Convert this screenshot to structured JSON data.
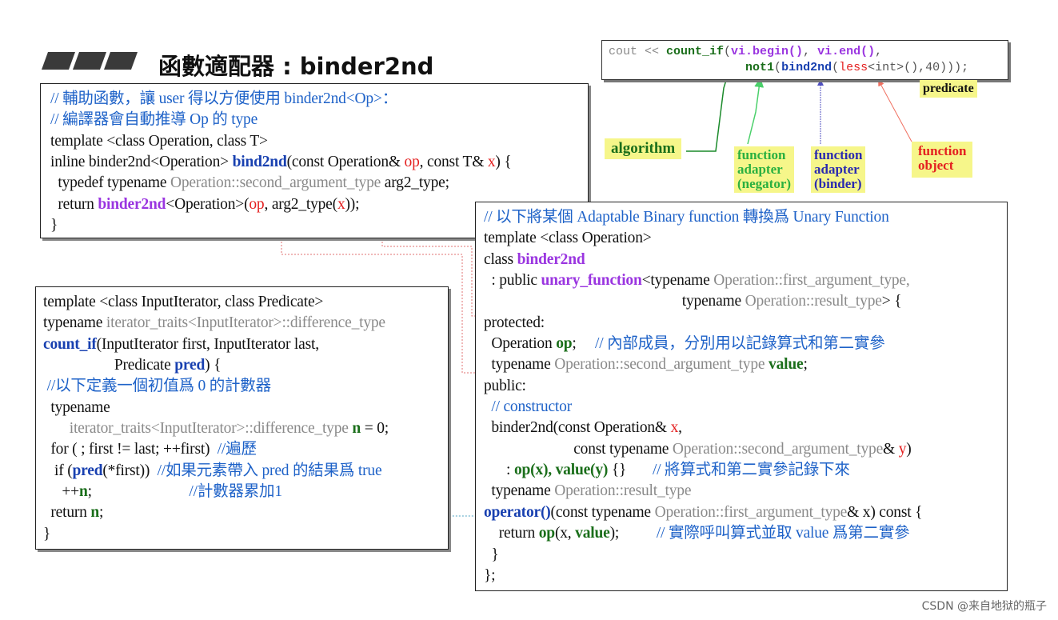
{
  "slide": {
    "title": "函數適配器 : binder2nd",
    "usage_code": [
      [
        [
          "cout << ",
          "gr"
        ],
        [
          "count_if",
          "g"
        ],
        [
          "(",
          "k"
        ],
        [
          "vi.begin()",
          "p"
        ],
        [
          ", ",
          "k"
        ],
        [
          "vi.end()",
          "p"
        ],
        [
          ",",
          "k"
        ]
      ],
      [
        [
          "                   ",
          "k"
        ],
        [
          "not1",
          "g"
        ],
        [
          "(",
          "k"
        ],
        [
          "bind2nd",
          "b"
        ],
        [
          "(",
          "k"
        ],
        [
          "less",
          "r"
        ],
        [
          "<int>(),40)));",
          "k"
        ]
      ]
    ],
    "labels": {
      "predicate": "predicate",
      "algorithm": "algorithm",
      "negator": [
        "function",
        "adapter",
        "(negator)"
      ],
      "binder": [
        "function",
        "adapter",
        "(binder)"
      ],
      "function_object": [
        "function",
        "object"
      ]
    },
    "bind2nd_box": [
      [
        [
          "// 輔助函數，讓 user 得以方便使用 binder2nd<Op>：",
          "c"
        ]
      ],
      [
        [
          "// 編譯器會自動推導 Op 的 type",
          "c"
        ]
      ],
      [
        [
          "template <class Operation, class T>",
          "k"
        ]
      ],
      [
        [
          "inline binder2nd<Operation> ",
          "k"
        ],
        [
          "bind2nd",
          "b"
        ],
        [
          "(const Operation& ",
          "k"
        ],
        [
          "op",
          "r"
        ],
        [
          ", const T& ",
          "k"
        ],
        [
          "x",
          "r"
        ],
        [
          ") {",
          "k"
        ]
      ],
      [
        [
          "  typedef typename ",
          "k"
        ],
        [
          "Operation::second_argument_type",
          "gr"
        ],
        [
          " arg2_type;",
          "k"
        ]
      ],
      [
        [
          "  return ",
          "k"
        ],
        [
          "binder2nd",
          "p"
        ],
        [
          "<Operation>(",
          "k"
        ],
        [
          "op",
          "r"
        ],
        [
          ", arg2_type(",
          "k"
        ],
        [
          "x",
          "r"
        ],
        [
          "));",
          "k"
        ]
      ],
      [
        [
          "}",
          "k"
        ]
      ]
    ],
    "count_if_box": [
      [
        [
          "template <class InputIterator, class Predicate>",
          "k"
        ]
      ],
      [
        [
          "typename ",
          "k"
        ],
        [
          "iterator_traits<InputIterator>::difference_type",
          "gr"
        ]
      ],
      [
        [
          "count_if",
          "b"
        ],
        [
          "(InputIterator first, InputIterator last,",
          "k"
        ]
      ],
      [
        [
          "                   Predicate ",
          "k"
        ],
        [
          "pred",
          "b"
        ],
        [
          ") {",
          "k"
        ]
      ],
      [
        [
          " //以下定義一個初值爲 0 的計數器",
          "c"
        ]
      ],
      [
        [
          "  typename",
          "k"
        ]
      ],
      [
        [
          "       iterator_traits<InputIterator>::difference_type ",
          "gr"
        ],
        [
          "n",
          "g"
        ],
        [
          " = 0;",
          "k"
        ]
      ],
      [
        [
          "  for ( ; first != last; ++first)  ",
          "k"
        ],
        [
          "//遍歷",
          "c"
        ]
      ],
      [
        [
          "   if (",
          "k"
        ],
        [
          "pred",
          "b"
        ],
        [
          "(*first))  ",
          "k"
        ],
        [
          "//如果元素帶入 pred 的結果爲 true",
          "c"
        ]
      ],
      [
        [
          "     ++",
          "k"
        ],
        [
          "n",
          "g"
        ],
        [
          ";                          ",
          "k"
        ],
        [
          "//計數器累加1",
          "c"
        ]
      ],
      [
        [
          "  return ",
          "k"
        ],
        [
          "n",
          "g"
        ],
        [
          ";",
          "k"
        ]
      ],
      [
        [
          "}",
          "k"
        ]
      ]
    ],
    "binder2nd_box": [
      [
        [
          "// 以下將某個 Adaptable Binary function 轉換爲 Unary Function",
          "c"
        ]
      ],
      [
        [
          "template <class Operation>",
          "k"
        ]
      ],
      [
        [
          "class ",
          "k"
        ],
        [
          "binder2nd",
          "p"
        ]
      ],
      [
        [
          "  : public ",
          "k"
        ],
        [
          "unary_function",
          "p"
        ],
        [
          "<typename ",
          "k"
        ],
        [
          "Operation::first_argument_type,",
          "gr"
        ]
      ],
      [
        [
          "                                                     typename ",
          "k"
        ],
        [
          "Operation::result_type",
          "gr"
        ],
        [
          "> {",
          "k"
        ]
      ],
      [
        [
          "protected:",
          "k"
        ]
      ],
      [
        [
          "  Operation ",
          "k"
        ],
        [
          "op",
          "g"
        ],
        [
          ";     ",
          "k"
        ],
        [
          "// 內部成員，分別用以記錄算式和第二實參",
          "c"
        ]
      ],
      [
        [
          "  typename ",
          "k"
        ],
        [
          "Operation::second_argument_type ",
          "gr"
        ],
        [
          "value",
          "g"
        ],
        [
          ";",
          "k"
        ]
      ],
      [
        [
          "public:",
          "k"
        ]
      ],
      [
        [
          "  // constructor",
          "c"
        ]
      ],
      [
        [
          "  binder2nd(const Operation& ",
          "k"
        ],
        [
          "x",
          "r"
        ],
        [
          ",",
          "k"
        ]
      ],
      [
        [
          "                        const typename ",
          "k"
        ],
        [
          "Operation::second_argument_type",
          "gr"
        ],
        [
          "& ",
          "k"
        ],
        [
          "y",
          "r"
        ],
        [
          ")",
          "k"
        ]
      ],
      [
        [
          "      : ",
          "k"
        ],
        [
          "op(x), value(y)",
          "g"
        ],
        [
          " {}       ",
          "k"
        ],
        [
          "// 將算式和第二實參記錄下來",
          "c"
        ]
      ],
      [
        [
          "  typename ",
          "k"
        ],
        [
          "Operation::result_type",
          "gr"
        ]
      ],
      [
        [
          "operator()",
          "b"
        ],
        [
          "(const typename ",
          "k"
        ],
        [
          "Operation::first_argument_type",
          "gr"
        ],
        [
          "& x) const {",
          "k"
        ]
      ],
      [
        [
          "    return ",
          "k"
        ],
        [
          "op",
          "g"
        ],
        [
          "(x, ",
          "k"
        ],
        [
          "value",
          "g"
        ],
        [
          ");          ",
          "k"
        ],
        [
          "// 實際呼叫算式並取 value 爲第二實參",
          "c"
        ]
      ],
      [
        [
          "  }",
          "k"
        ]
      ],
      [
        [
          "};",
          "k"
        ]
      ]
    ],
    "footer": "CSDN @来自地狱的瓶子"
  },
  "colors": {
    "comment": "#1e62c8",
    "keyword_purple": "#9a35e0",
    "green": "#1a6e1a",
    "red": "#e42020",
    "gray": "#8a8a8a",
    "label_bg": "#f6f68a"
  }
}
